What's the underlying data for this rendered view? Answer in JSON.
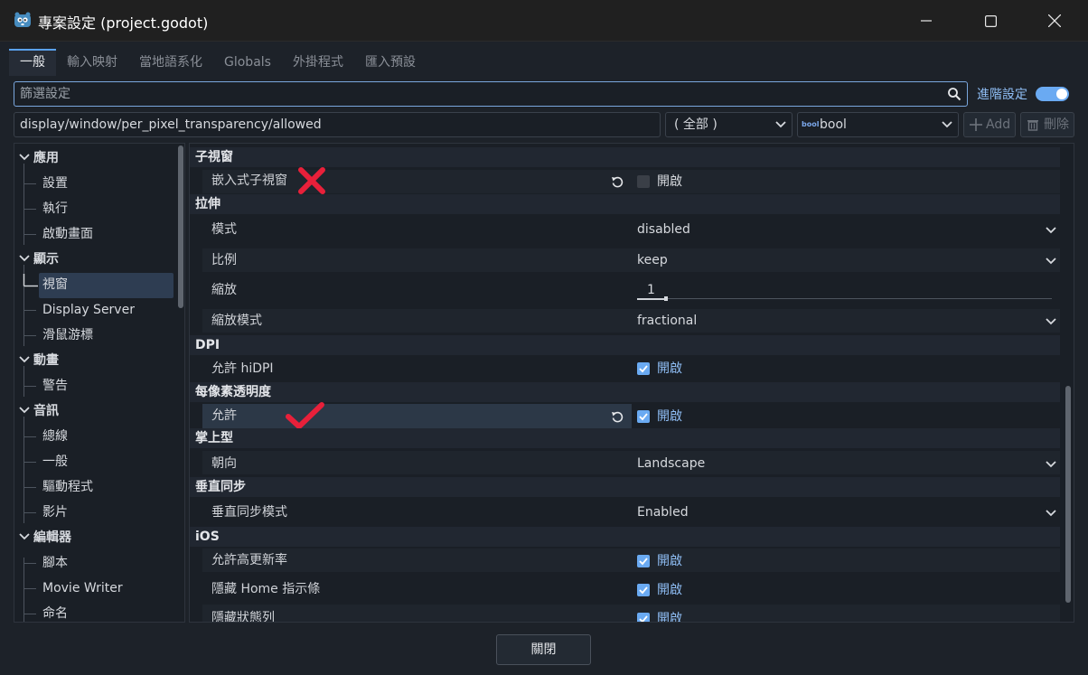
{
  "window": {
    "title": "專案設定 (project.godot)"
  },
  "tabs": [
    "一般",
    "輸入映射",
    "當地語系化",
    "Globals",
    "外掛程式",
    "匯入預設"
  ],
  "toolbar": {
    "filter_placeholder": "篩選設定",
    "advanced_label": "進階設定",
    "advanced_enabled": true,
    "path_value": "display/window/per_pixel_transparency/allowed",
    "category_select": "( 全部 )",
    "type_badge": "bool",
    "type_select": "bool",
    "add_label": "Add",
    "delete_label": "刪除"
  },
  "sidebar": {
    "items": [
      {
        "label": "應用",
        "type": "category"
      },
      {
        "label": "設置",
        "type": "child"
      },
      {
        "label": "執行",
        "type": "child"
      },
      {
        "label": "啟動畫面",
        "type": "child"
      },
      {
        "label": "顯示",
        "type": "category"
      },
      {
        "label": "視窗",
        "type": "child",
        "selected": true
      },
      {
        "label": "Display Server",
        "type": "child"
      },
      {
        "label": "滑鼠游標",
        "type": "child"
      },
      {
        "label": "動畫",
        "type": "category"
      },
      {
        "label": "警告",
        "type": "child"
      },
      {
        "label": "音訊",
        "type": "category"
      },
      {
        "label": "總線",
        "type": "child"
      },
      {
        "label": "一般",
        "type": "child"
      },
      {
        "label": "驅動程式",
        "type": "child"
      },
      {
        "label": "影片",
        "type": "child"
      },
      {
        "label": "編輯器",
        "type": "category"
      },
      {
        "label": "腳本",
        "type": "child"
      },
      {
        "label": "Movie Writer",
        "type": "child"
      },
      {
        "label": "命名",
        "type": "child"
      }
    ]
  },
  "settings": {
    "sections": [
      {
        "title": "子視窗",
        "rows": [
          {
            "label": "嵌入式子視窗",
            "kind": "checkbox",
            "checked": false,
            "value": "開啟",
            "revert": true,
            "annotation": "cross"
          }
        ]
      },
      {
        "title": "拉伸",
        "rows": [
          {
            "label": "模式",
            "kind": "dropdown",
            "value": "disabled"
          },
          {
            "label": "比例",
            "kind": "dropdown",
            "value": "keep"
          },
          {
            "label": "縮放",
            "kind": "slider",
            "value": "1"
          },
          {
            "label": "縮放模式",
            "kind": "dropdown",
            "value": "fractional"
          }
        ]
      },
      {
        "title": "DPI",
        "rows": [
          {
            "label": "允許 hiDPI",
            "kind": "checkbox",
            "checked": true,
            "value": "開啟"
          }
        ]
      },
      {
        "title": "每像素透明度",
        "rows": [
          {
            "label": "允許",
            "kind": "checkbox",
            "checked": true,
            "value": "開啟",
            "revert": true,
            "highlighted": true,
            "annotation": "check"
          }
        ]
      },
      {
        "title": "掌上型",
        "rows": [
          {
            "label": "朝向",
            "kind": "dropdown",
            "value": "Landscape"
          }
        ]
      },
      {
        "title": "垂直同步",
        "rows": [
          {
            "label": "垂直同步模式",
            "kind": "dropdown",
            "value": "Enabled"
          }
        ]
      },
      {
        "title": "iOS",
        "rows": [
          {
            "label": "允許高更新率",
            "kind": "checkbox",
            "checked": true,
            "value": "開啟"
          },
          {
            "label": "隱藏 Home 指示條",
            "kind": "checkbox",
            "checked": true,
            "value": "開啟"
          },
          {
            "label": "隱藏狀態列",
            "kind": "checkbox",
            "checked": true,
            "value": "開啟"
          }
        ]
      }
    ]
  },
  "footer": {
    "close_label": "關閉"
  },
  "colors": {
    "accent": "#6aaaf2",
    "background": "#1d2229",
    "panel": "#1a1f26",
    "cross_mark": "#e8203a",
    "check_mark": "#e8203a"
  }
}
